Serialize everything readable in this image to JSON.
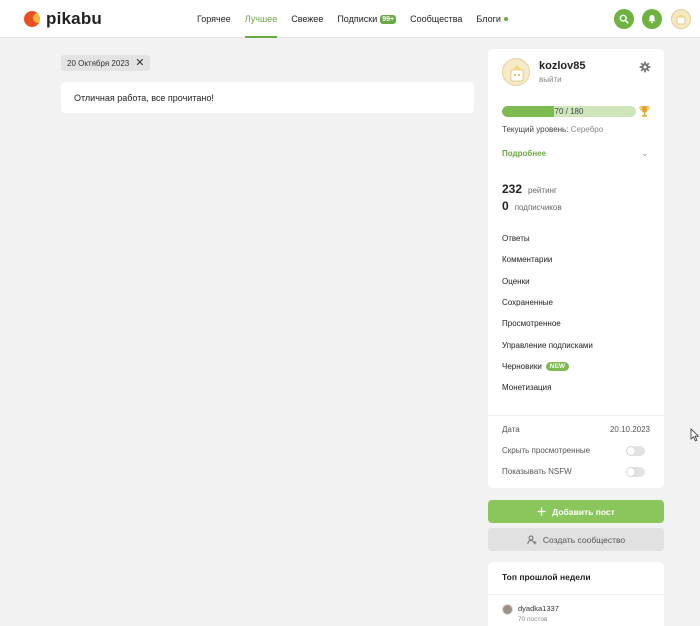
{
  "header": {
    "logo_text": "pikabu",
    "nav": [
      {
        "label": "Горячее"
      },
      {
        "label": "Лучшее",
        "active": true
      },
      {
        "label": "Свежее"
      },
      {
        "label": "Подписки",
        "badge": "99+"
      },
      {
        "label": "Сообщества"
      },
      {
        "label": "Блоги"
      }
    ],
    "icons": [
      "search-icon",
      "bell-icon",
      "avatar"
    ]
  },
  "filter": {
    "date_chip": "20 Октября 2023"
  },
  "main": {
    "message": "Отличная работа, все прочитано!"
  },
  "profile": {
    "username": "kozlov85",
    "logout": "выйти",
    "progress_text": "70 / 180",
    "progress_fraction": 0.389,
    "level_label": "Текущий уровень:",
    "level_value": "Серебро",
    "more_label": "Подробнее",
    "rating_value": "232",
    "rating_label": "рейтинг",
    "subscribers_value": "0",
    "subscribers_label": "подписчиков",
    "menu": [
      {
        "label": "Ответы"
      },
      {
        "label": "Комментарии"
      },
      {
        "label": "Оценки"
      },
      {
        "label": "Сохраненные"
      },
      {
        "label": "Просмотренное"
      },
      {
        "label": "Управление подписками"
      },
      {
        "label": "Черновики",
        "badge": "NEW"
      },
      {
        "label": "Монетизация"
      }
    ],
    "date_label": "Дата",
    "date_value": "20.10.2023",
    "hide_viewed_label": "Скрыть просмотренные",
    "nsfw_label": "Показывать NSFW"
  },
  "actions": {
    "add_post": "Добавить пост",
    "create_community": "Создать сообщество"
  },
  "top_week": {
    "title": "Топ прошлой недели",
    "user": "dyadka1337",
    "posts": "70 постов"
  },
  "colors": {
    "accent": "#6aa842",
    "button": "#8ac65c"
  }
}
